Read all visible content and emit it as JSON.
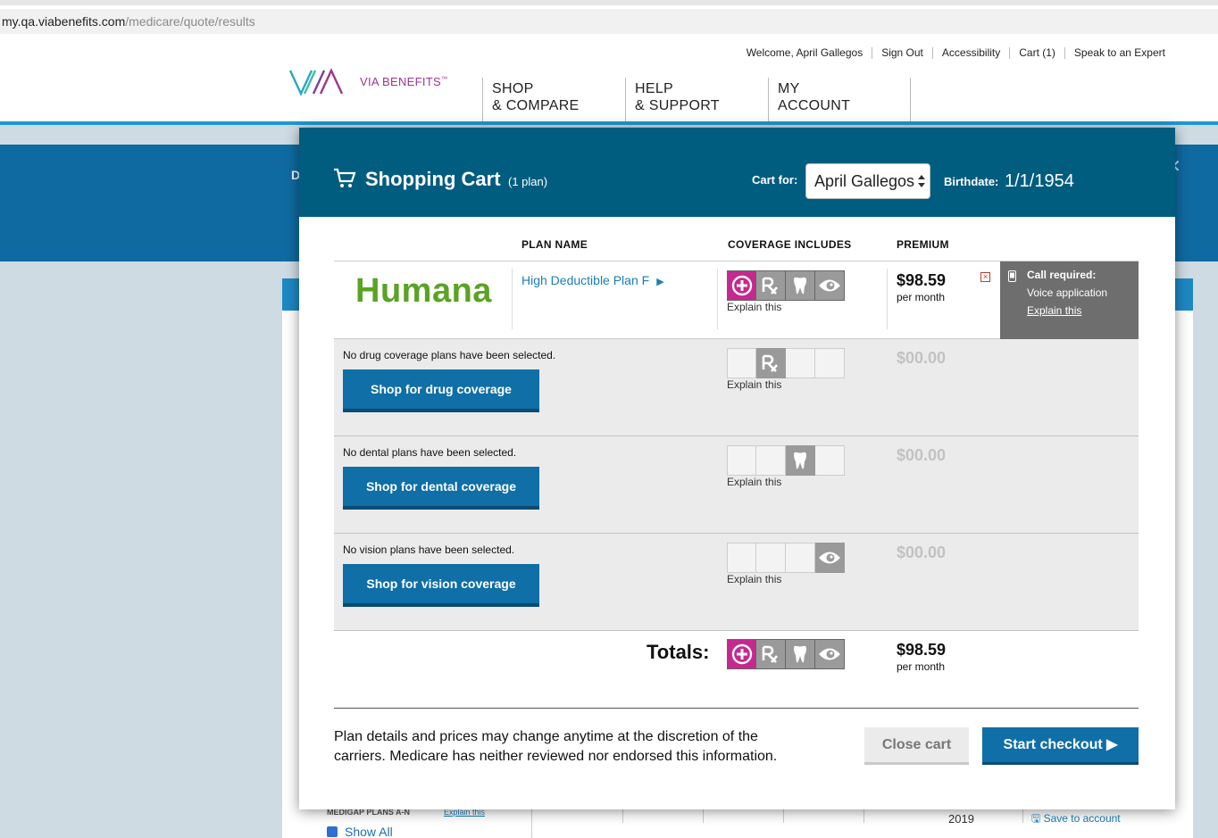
{
  "browser": {
    "url_domain": "my.qa.viabenefits.com",
    "url_path": "/medicare/quote/results"
  },
  "header": {
    "welcome": "Welcome, April Gallegos",
    "links": [
      "Sign Out",
      "Accessibility",
      "Cart (1)",
      "Speak to an Expert"
    ],
    "logo_text": "VIA BENEFITS",
    "logo_tm": "™",
    "nav": [
      {
        "line1": "SHOP",
        "line2": "& COMPARE"
      },
      {
        "line1": "HELP",
        "line2": "& SUPPORT"
      },
      {
        "line1": "MY",
        "line2": "ACCOUNT"
      }
    ],
    "accent_color": "#1d9ad0"
  },
  "background": {
    "d_letter": "D",
    "close_glyph": "✕",
    "medigap_label": "MEDIGAP PLANS A-N",
    "explain_link": "Explain this",
    "show_all": "Show All",
    "year": "2019",
    "save_to_account": "Save to account"
  },
  "cart": {
    "title": "Shopping Cart",
    "count": "(1 plan)",
    "cart_for_label": "Cart for:",
    "cart_for_value": "April Gallegos",
    "birthdate_label": "Birthdate:",
    "birthdate_value": "1/1/1954",
    "columns": {
      "plan_name": "PLAN NAME",
      "coverage": "COVERAGE INCLUDES",
      "premium": "PREMIUM"
    },
    "plan": {
      "carrier": "Humana",
      "name": "High Deductible Plan F",
      "arrow": "▶",
      "explain": "Explain this",
      "price": "$98.59",
      "per": "per month",
      "remove": "×",
      "call_title": "Call required:",
      "call_sub": "Voice application",
      "call_link": "Explain this"
    },
    "slots": [
      {
        "none_text": "No drug coverage plans have been selected.",
        "button": "Shop for drug coverage",
        "explain": "Explain this",
        "price": "$00.00"
      },
      {
        "none_text": "No dental plans have been selected.",
        "button": "Shop for dental coverage",
        "explain": "Explain this",
        "price": "$00.00"
      },
      {
        "none_text": "No vision plans have been selected.",
        "button": "Shop for vision coverage",
        "explain": "Explain this",
        "price": "$00.00"
      }
    ],
    "totals": {
      "label": "Totals:",
      "price": "$98.59",
      "per": "per month"
    },
    "disclaimer": "Plan details and prices may change anytime at the discretion of the carriers. Medicare has neither reviewed nor endorsed this information.",
    "close_button": "Close cart",
    "checkout_button": "Start checkout ▶",
    "colors": {
      "header_bg": "#005d7f",
      "button_bg": "#0f6fa6",
      "medical_magenta": "#c4298f",
      "humana_green": "#5aa323"
    }
  }
}
